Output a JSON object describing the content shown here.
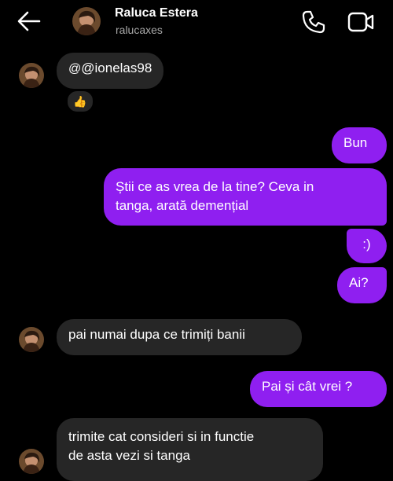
{
  "header": {
    "name": "Raluca Estera",
    "username": "ralucaxes",
    "icons": [
      "back-arrow-icon",
      "phone-icon",
      "video-camera-icon"
    ]
  },
  "messages": [
    {
      "from": "them",
      "text": "@ionelas98",
      "reaction": "👍"
    },
    {
      "from": "me",
      "text": "Bun"
    },
    {
      "from": "me",
      "text_line1": "Știi ce as vrea de la tine? Ceva in",
      "text_line2": "tanga, arată demențial"
    },
    {
      "from": "me",
      "text": ":)"
    },
    {
      "from": "me",
      "text": "Ai?"
    },
    {
      "from": "them",
      "text": "pai numai dupa ce trimiți banii"
    },
    {
      "from": "me",
      "text": "Pai și cât vrei ?"
    },
    {
      "from": "them",
      "text_line1": "trimite cat consideri si in functie",
      "text_line2": "de asta vezi si tanga"
    }
  ],
  "colors": {
    "background": "#000000",
    "incoming_bubble": "#262626",
    "outgoing_bubble": "#8f1ff0"
  }
}
